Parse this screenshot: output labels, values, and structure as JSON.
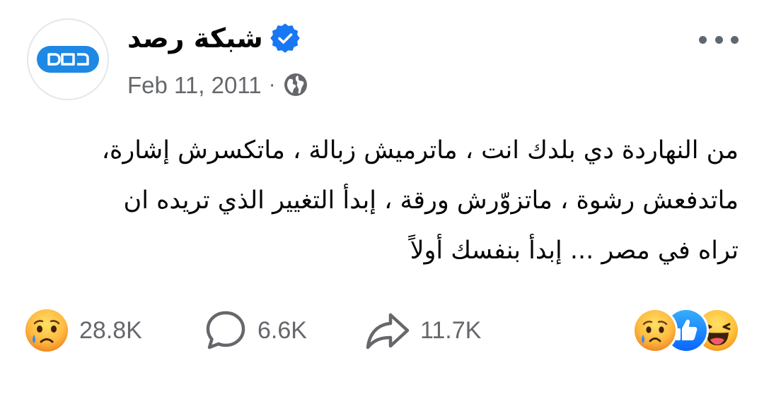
{
  "page": {
    "name": "شبكة رصد",
    "avatar_logo": "رصد",
    "verified": true
  },
  "post": {
    "date": "Feb 11, 2011",
    "separator": "·",
    "audience_icon": "globe-icon",
    "text_lines": [
      "من النهاردة دي بلدك انت ، ماترميش زبالة ، ماتكسرش إشارة،",
      "ماتدفعش رشوة ، ماتزوّرش ورقة ، إبدأ التغيير الذي تريده ان",
      "تراه في مصر ... إبدأ بنفسك أولاً"
    ]
  },
  "stats": {
    "reactions": "28.8K",
    "comments": "6.6K",
    "shares": "11.7K"
  },
  "reaction_icons": [
    "haha-icon",
    "like-icon",
    "sad-icon"
  ],
  "colors": {
    "brand_blue": "#1e88e5",
    "verified_blue": "#1877f2",
    "secondary_text": "#65676b",
    "primary_text": "#050505"
  }
}
